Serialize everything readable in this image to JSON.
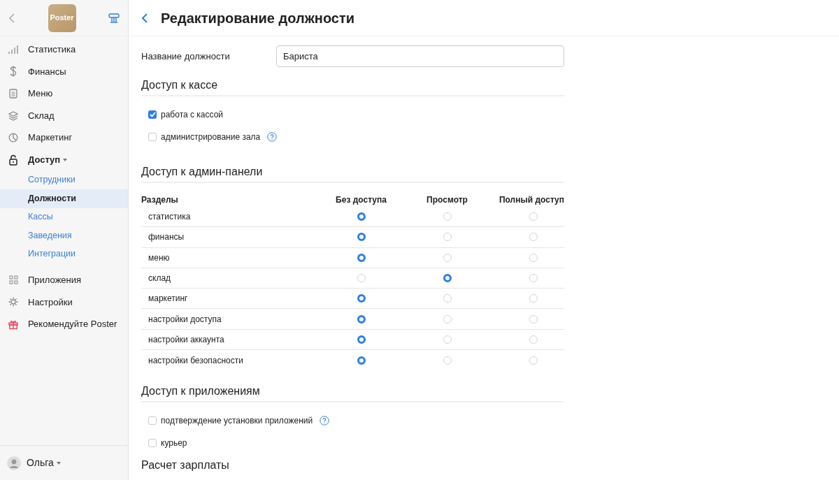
{
  "sidebar": {
    "logo": "Poster",
    "items": [
      {
        "label": "Статистика",
        "expanded": false
      },
      {
        "label": "Финансы",
        "expanded": false
      },
      {
        "label": "Меню",
        "expanded": false
      },
      {
        "label": "Склад",
        "expanded": false
      },
      {
        "label": "Маркетинг",
        "expanded": false
      },
      {
        "label": "Доступ",
        "expanded": true,
        "children": [
          {
            "label": "Сотрудники",
            "selected": false
          },
          {
            "label": "Должности",
            "selected": true
          },
          {
            "label": "Кассы",
            "selected": false
          },
          {
            "label": "Заведения",
            "selected": false
          },
          {
            "label": "Интеграции",
            "selected": false
          }
        ]
      },
      {
        "label": "Приложения",
        "expanded": false
      },
      {
        "label": "Настройки",
        "expanded": false
      },
      {
        "label": "Рекомендуйте Poster",
        "expanded": false
      }
    ],
    "user": "Ольга"
  },
  "page": {
    "title": "Редактирование должности"
  },
  "position_name": {
    "label": "Название должности",
    "value": "Бариста"
  },
  "cash_access": {
    "heading": "Доступ к кассе",
    "options": [
      {
        "label": "работа с кассой",
        "checked": true,
        "help": false
      },
      {
        "label": "администрирование зала",
        "checked": false,
        "help": true
      }
    ]
  },
  "admin_access": {
    "heading": "Доступ к админ-панели",
    "columns": [
      "Разделы",
      "Без доступа",
      "Просмотр",
      "Полный доступ"
    ],
    "rows": [
      {
        "section": "статистика",
        "radios": [
          {
            "selected": true
          },
          {
            "selected": false
          },
          {
            "selected": false
          }
        ]
      },
      {
        "section": "финансы",
        "radios": [
          {
            "selected": true
          },
          {
            "selected": false
          },
          {
            "selected": false
          }
        ]
      },
      {
        "section": "меню",
        "radios": [
          {
            "selected": true
          },
          {
            "selected": false
          },
          {
            "selected": false
          }
        ]
      },
      {
        "section": "склад",
        "radios": [
          {
            "selected": false
          },
          {
            "selected": true
          },
          {
            "selected": false
          }
        ]
      },
      {
        "section": "маркетинг",
        "radios": [
          {
            "selected": true
          },
          {
            "selected": false
          },
          {
            "selected": false
          }
        ]
      },
      {
        "section": "настройки доступа",
        "radios": [
          {
            "selected": true
          },
          {
            "selected": false
          },
          {
            "selected": false
          }
        ]
      },
      {
        "section": "настройки аккаунта",
        "radios": [
          {
            "selected": true
          },
          {
            "selected": false
          },
          {
            "selected": false
          }
        ]
      },
      {
        "section": "настройки безопасности",
        "radios": [
          {
            "selected": true
          },
          {
            "selected": false
          },
          {
            "selected": false
          }
        ]
      }
    ]
  },
  "app_access": {
    "heading": "Доступ к приложениям",
    "options": [
      {
        "label": "подтверждение установки приложений",
        "checked": false,
        "help": true
      },
      {
        "label": "курьер",
        "checked": false,
        "help": false
      }
    ]
  },
  "salary": {
    "heading": "Расчет зарплаты"
  }
}
